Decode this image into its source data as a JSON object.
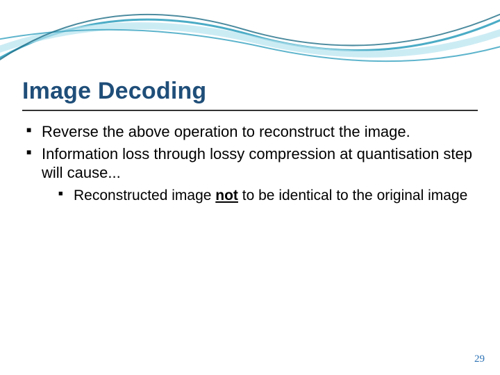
{
  "title": "Image Decoding",
  "bullets": {
    "b1": "Reverse the above operation to reconstruct the image.",
    "b2": "Information loss through lossy compression at quantisation step will cause...",
    "b2_sub_pre": "Reconstructed image ",
    "b2_sub_em": "not",
    "b2_sub_post": " to be identical to the original image"
  },
  "page_number": "29"
}
